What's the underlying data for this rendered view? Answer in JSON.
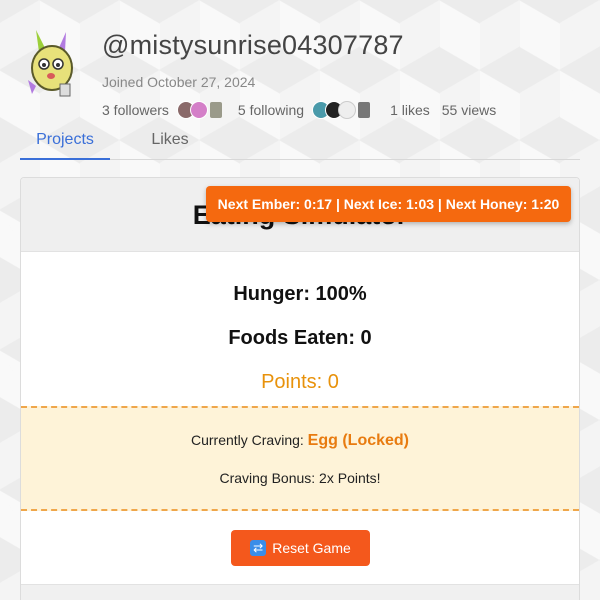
{
  "profile": {
    "username": "@mistysunrise04307787",
    "joined": "Joined October 27, 2024",
    "followers": "3 followers",
    "following": "5 following",
    "likes": "1 likes",
    "views": "55 views"
  },
  "tabs": [
    {
      "label": "Projects",
      "active": true
    },
    {
      "label": "Likes",
      "active": false
    }
  ],
  "game": {
    "title": "Eating Simulator",
    "timers": "Next Ember: 0:17 | Next Ice: 1:03 | Next Honey: 1:20",
    "hunger": "Hunger: 100%",
    "foods_eaten": "Foods Eaten: 0",
    "points": "Points: 0",
    "craving_label": "Currently Craving: ",
    "craving_item": "Egg (Locked)",
    "craving_bonus": "Craving Bonus: 2x Points!",
    "reset_label": "Reset Game"
  },
  "colors": {
    "accent_blue": "#3a6fd8",
    "banner_orange": "#f5690f",
    "points_orange": "#e8920b",
    "reset_button": "#f4581c",
    "craving_bg": "#fef3d8"
  },
  "icons": [
    "avatar-character-icon",
    "reset-arrows-icon"
  ]
}
